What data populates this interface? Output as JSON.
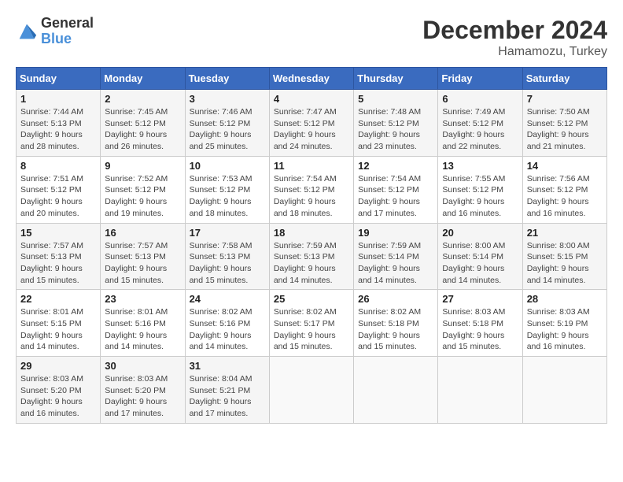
{
  "header": {
    "logo_general": "General",
    "logo_blue": "Blue",
    "month_title": "December 2024",
    "location": "Hamamozu, Turkey"
  },
  "days_of_week": [
    "Sunday",
    "Monday",
    "Tuesday",
    "Wednesday",
    "Thursday",
    "Friday",
    "Saturday"
  ],
  "weeks": [
    [
      {
        "day": "1",
        "sunrise": "Sunrise: 7:44 AM",
        "sunset": "Sunset: 5:13 PM",
        "daylight": "Daylight: 9 hours and 28 minutes."
      },
      {
        "day": "2",
        "sunrise": "Sunrise: 7:45 AM",
        "sunset": "Sunset: 5:12 PM",
        "daylight": "Daylight: 9 hours and 26 minutes."
      },
      {
        "day": "3",
        "sunrise": "Sunrise: 7:46 AM",
        "sunset": "Sunset: 5:12 PM",
        "daylight": "Daylight: 9 hours and 25 minutes."
      },
      {
        "day": "4",
        "sunrise": "Sunrise: 7:47 AM",
        "sunset": "Sunset: 5:12 PM",
        "daylight": "Daylight: 9 hours and 24 minutes."
      },
      {
        "day": "5",
        "sunrise": "Sunrise: 7:48 AM",
        "sunset": "Sunset: 5:12 PM",
        "daylight": "Daylight: 9 hours and 23 minutes."
      },
      {
        "day": "6",
        "sunrise": "Sunrise: 7:49 AM",
        "sunset": "Sunset: 5:12 PM",
        "daylight": "Daylight: 9 hours and 22 minutes."
      },
      {
        "day": "7",
        "sunrise": "Sunrise: 7:50 AM",
        "sunset": "Sunset: 5:12 PM",
        "daylight": "Daylight: 9 hours and 21 minutes."
      }
    ],
    [
      {
        "day": "8",
        "sunrise": "Sunrise: 7:51 AM",
        "sunset": "Sunset: 5:12 PM",
        "daylight": "Daylight: 9 hours and 20 minutes."
      },
      {
        "day": "9",
        "sunrise": "Sunrise: 7:52 AM",
        "sunset": "Sunset: 5:12 PM",
        "daylight": "Daylight: 9 hours and 19 minutes."
      },
      {
        "day": "10",
        "sunrise": "Sunrise: 7:53 AM",
        "sunset": "Sunset: 5:12 PM",
        "daylight": "Daylight: 9 hours and 18 minutes."
      },
      {
        "day": "11",
        "sunrise": "Sunrise: 7:54 AM",
        "sunset": "Sunset: 5:12 PM",
        "daylight": "Daylight: 9 hours and 18 minutes."
      },
      {
        "day": "12",
        "sunrise": "Sunrise: 7:54 AM",
        "sunset": "Sunset: 5:12 PM",
        "daylight": "Daylight: 9 hours and 17 minutes."
      },
      {
        "day": "13",
        "sunrise": "Sunrise: 7:55 AM",
        "sunset": "Sunset: 5:12 PM",
        "daylight": "Daylight: 9 hours and 16 minutes."
      },
      {
        "day": "14",
        "sunrise": "Sunrise: 7:56 AM",
        "sunset": "Sunset: 5:12 PM",
        "daylight": "Daylight: 9 hours and 16 minutes."
      }
    ],
    [
      {
        "day": "15",
        "sunrise": "Sunrise: 7:57 AM",
        "sunset": "Sunset: 5:13 PM",
        "daylight": "Daylight: 9 hours and 15 minutes."
      },
      {
        "day": "16",
        "sunrise": "Sunrise: 7:57 AM",
        "sunset": "Sunset: 5:13 PM",
        "daylight": "Daylight: 9 hours and 15 minutes."
      },
      {
        "day": "17",
        "sunrise": "Sunrise: 7:58 AM",
        "sunset": "Sunset: 5:13 PM",
        "daylight": "Daylight: 9 hours and 15 minutes."
      },
      {
        "day": "18",
        "sunrise": "Sunrise: 7:59 AM",
        "sunset": "Sunset: 5:13 PM",
        "daylight": "Daylight: 9 hours and 14 minutes."
      },
      {
        "day": "19",
        "sunrise": "Sunrise: 7:59 AM",
        "sunset": "Sunset: 5:14 PM",
        "daylight": "Daylight: 9 hours and 14 minutes."
      },
      {
        "day": "20",
        "sunrise": "Sunrise: 8:00 AM",
        "sunset": "Sunset: 5:14 PM",
        "daylight": "Daylight: 9 hours and 14 minutes."
      },
      {
        "day": "21",
        "sunrise": "Sunrise: 8:00 AM",
        "sunset": "Sunset: 5:15 PM",
        "daylight": "Daylight: 9 hours and 14 minutes."
      }
    ],
    [
      {
        "day": "22",
        "sunrise": "Sunrise: 8:01 AM",
        "sunset": "Sunset: 5:15 PM",
        "daylight": "Daylight: 9 hours and 14 minutes."
      },
      {
        "day": "23",
        "sunrise": "Sunrise: 8:01 AM",
        "sunset": "Sunset: 5:16 PM",
        "daylight": "Daylight: 9 hours and 14 minutes."
      },
      {
        "day": "24",
        "sunrise": "Sunrise: 8:02 AM",
        "sunset": "Sunset: 5:16 PM",
        "daylight": "Daylight: 9 hours and 14 minutes."
      },
      {
        "day": "25",
        "sunrise": "Sunrise: 8:02 AM",
        "sunset": "Sunset: 5:17 PM",
        "daylight": "Daylight: 9 hours and 15 minutes."
      },
      {
        "day": "26",
        "sunrise": "Sunrise: 8:02 AM",
        "sunset": "Sunset: 5:18 PM",
        "daylight": "Daylight: 9 hours and 15 minutes."
      },
      {
        "day": "27",
        "sunrise": "Sunrise: 8:03 AM",
        "sunset": "Sunset: 5:18 PM",
        "daylight": "Daylight: 9 hours and 15 minutes."
      },
      {
        "day": "28",
        "sunrise": "Sunrise: 8:03 AM",
        "sunset": "Sunset: 5:19 PM",
        "daylight": "Daylight: 9 hours and 16 minutes."
      }
    ],
    [
      {
        "day": "29",
        "sunrise": "Sunrise: 8:03 AM",
        "sunset": "Sunset: 5:20 PM",
        "daylight": "Daylight: 9 hours and 16 minutes."
      },
      {
        "day": "30",
        "sunrise": "Sunrise: 8:03 AM",
        "sunset": "Sunset: 5:20 PM",
        "daylight": "Daylight: 9 hours and 17 minutes."
      },
      {
        "day": "31",
        "sunrise": "Sunrise: 8:04 AM",
        "sunset": "Sunset: 5:21 PM",
        "daylight": "Daylight: 9 hours and 17 minutes."
      },
      null,
      null,
      null,
      null
    ]
  ]
}
